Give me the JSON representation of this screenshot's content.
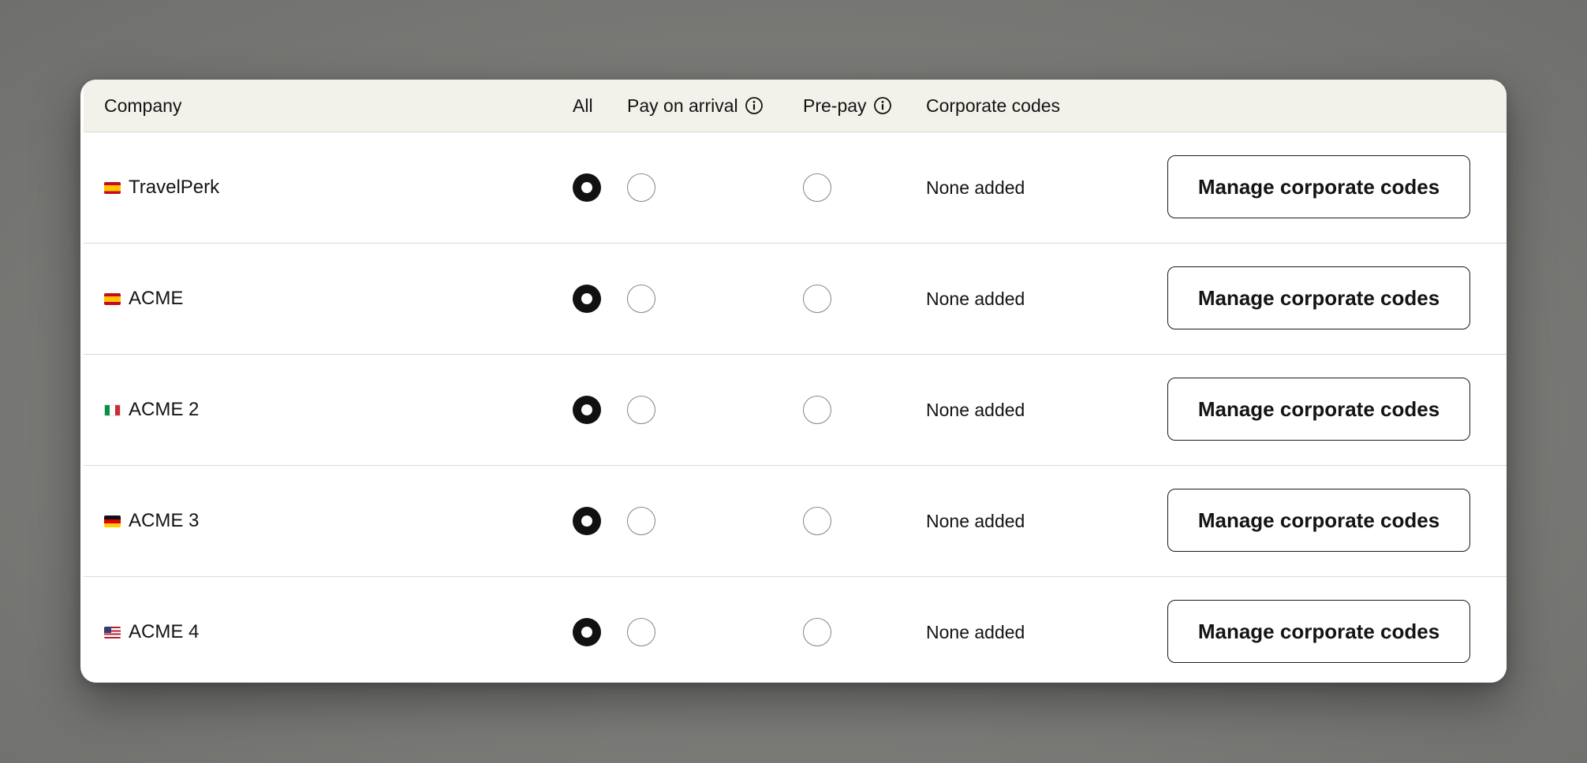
{
  "table": {
    "columns": {
      "company": "Company",
      "all": "All",
      "pay_on_arrival": "Pay on arrival",
      "pre_pay": "Pre-pay",
      "corporate_codes": "Corporate codes"
    },
    "rows": [
      {
        "company": "TravelPerk",
        "flag": "spain-flag-icon",
        "selected": "all",
        "codes": "None added",
        "button": "Manage corporate codes"
      },
      {
        "company": "ACME",
        "flag": "spain-flag-icon",
        "selected": "all",
        "codes": "None added",
        "button": "Manage corporate codes"
      },
      {
        "company": "ACME 2",
        "flag": "italy-flag-icon",
        "selected": "all",
        "codes": "None added",
        "button": "Manage corporate codes"
      },
      {
        "company": "ACME 3",
        "flag": "germany-flag-icon",
        "selected": "all",
        "codes": "None added",
        "button": "Manage corporate codes"
      },
      {
        "company": "ACME 4",
        "flag": "usa-flag-icon",
        "selected": "all",
        "codes": "None added",
        "button": "Manage corporate codes"
      }
    ]
  },
  "colors": {
    "header_bg": "#f2f1ea",
    "radio_selected": "#111111",
    "radio_unselected_border": "#858580",
    "backdrop": "#7a7a77"
  }
}
